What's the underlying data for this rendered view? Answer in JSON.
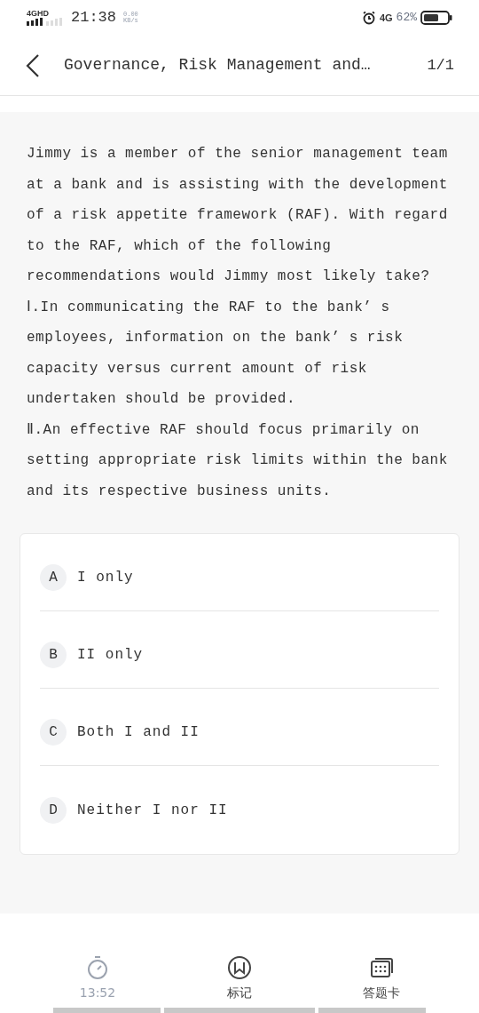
{
  "status_bar": {
    "network": "4GHD",
    "time": "21:38",
    "speed_value": "0.00",
    "speed_unit": "KB/s",
    "mobile": "4G",
    "battery": "62%"
  },
  "header": {
    "title": "Governance, Risk Management and…",
    "counter": "1/1"
  },
  "question": {
    "paragraphs": [
      "Jimmy is a member of the senior management team at a bank and is assisting with the development of a risk appetite framework (RAF). With regard to the RAF, which of the following recommendations would Jimmy most likely take?",
      "Ⅰ.In communicating the RAF to the bank’ s employees, information on the bank’ s risk capacity versus current amount of risk undertaken should be provided.",
      "Ⅱ.An effective RAF should focus primarily on setting appropriate risk limits within the bank and its respective business units."
    ]
  },
  "options": [
    {
      "letter": "A",
      "text": "I only"
    },
    {
      "letter": "B",
      "text": "II only"
    },
    {
      "letter": "C",
      "text": "Both I and II"
    },
    {
      "letter": "D",
      "text": "Neither I nor II"
    }
  ],
  "bottom_bar": [
    {
      "kind": "timer",
      "label": "13:52"
    },
    {
      "kind": "mark",
      "label": "标记"
    },
    {
      "kind": "card",
      "label": "答题卡"
    }
  ]
}
